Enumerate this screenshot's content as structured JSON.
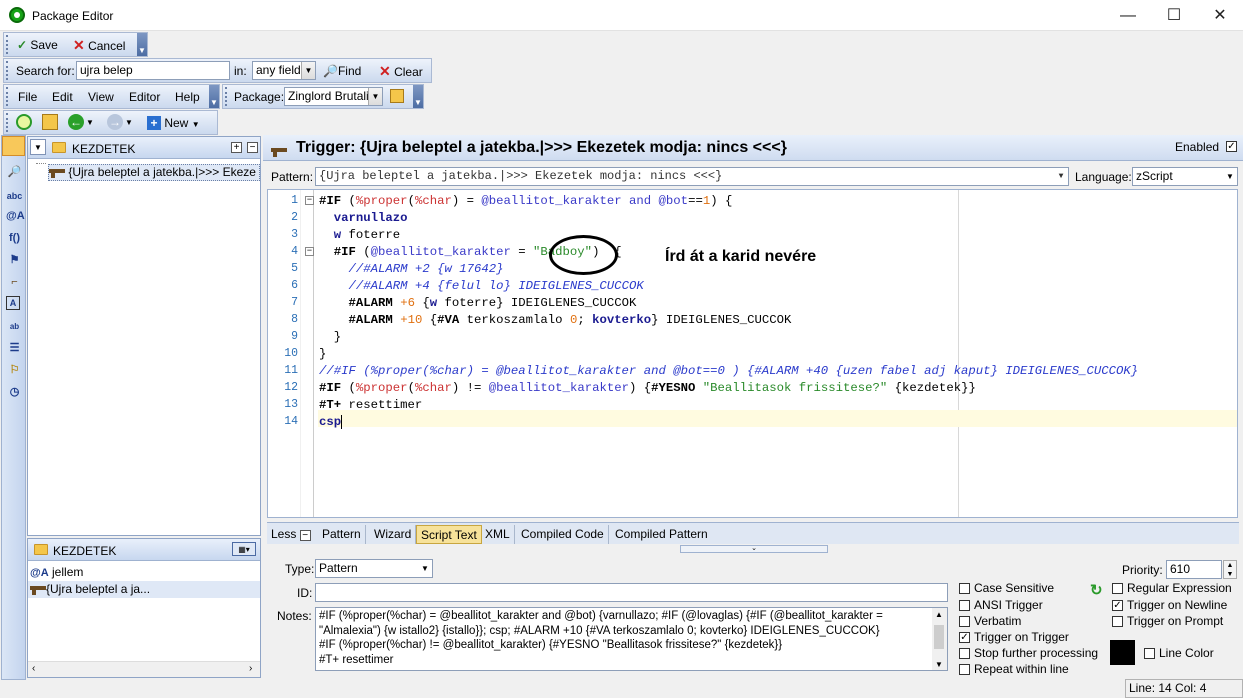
{
  "window": {
    "title": "Package Editor",
    "minimize": "—",
    "maximize": "☐",
    "close": "✕"
  },
  "toolbar_save": {
    "save": "Save",
    "cancel": "Cancel"
  },
  "search": {
    "label": "Search for:",
    "value": "ujra belep",
    "in_label": "in:",
    "field": "any field",
    "find": "Find",
    "clear": "Clear"
  },
  "menu": {
    "file": "File",
    "edit": "Edit",
    "view": "View",
    "editor": "Editor",
    "help": "Help"
  },
  "package": {
    "label": "Package:",
    "value": "Zinglord Brutali"
  },
  "toolbar_nav": {
    "new": "New"
  },
  "tree": {
    "root": "KEZDETEK",
    "item": "{Ujra beleptel a jatekba.|>>> Ekeze"
  },
  "tree2": {
    "root": "KEZDETEK",
    "items": [
      "jellem",
      "{Ujra beleptel a ja..."
    ]
  },
  "trigger": {
    "title": "Trigger: {Ujra beleptel a jatekba.|>>> Ekezetek modja: nincs <<<}",
    "enabled_label": "Enabled"
  },
  "pattern": {
    "label": "Pattern:",
    "value": "{Ujra beleptel a jatekba.|>>> Ekezetek modja: nincs <<<}",
    "language_label": "Language:",
    "language": "zScript"
  },
  "annotation": "Írd át a karid nevére",
  "code_lines": [
    "1",
    "2",
    "3",
    "4",
    "5",
    "6",
    "7",
    "8",
    "9",
    "10",
    "11",
    "12",
    "13",
    "14"
  ],
  "tabs": {
    "less": "Less",
    "items": [
      "Pattern",
      "Wizard",
      "Script Text",
      "XML",
      "Compiled Code",
      "Compiled Pattern"
    ]
  },
  "form": {
    "type_label": "Type:",
    "type_value": "Pattern",
    "id_label": "ID:",
    "notes_label": "Notes:",
    "notes": [
      "#IF (%proper(%char) = @beallitot_karakter and @bot) {varnullazo; #IF (@lovaglas) {#IF (@beallitot_karakter =",
      "\"Almalexia\") {w istallo2} {istallo}}; csp; #ALARM +10 {#VA terkoszamlalo 0; kovterko} IDEIGLENES_CUCCOK}",
      "#IF (%proper(%char) != @beallitot_karakter) {#YESNO \"Beallitasok frissitese?\" {kezdetek}}",
      "#T+ resettimer"
    ],
    "priority_label": "Priority:",
    "priority": "610"
  },
  "options": {
    "case_sensitive": "Case Sensitive",
    "ansi_trigger": "ANSI Trigger",
    "verbatim": "Verbatim",
    "trigger_on_trigger": "Trigger on Trigger",
    "stop_further": "Stop further processing",
    "repeat_within_line": "Repeat within line",
    "regex": "Regular Expression",
    "trigger_on_newline": "Trigger on Newline",
    "trigger_on_prompt": "Trigger on Prompt",
    "line_color": "Line Color"
  },
  "status": {
    "position": "Line: 14 Col: 4"
  }
}
